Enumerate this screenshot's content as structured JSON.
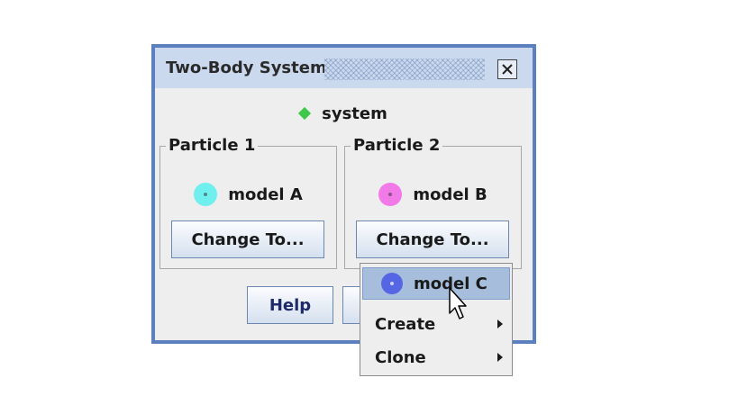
{
  "window": {
    "title": "Two-Body System",
    "system_label": "system",
    "particle1": {
      "legend": "Particle 1",
      "model": "model A",
      "change_label": "Change To..."
    },
    "particle2": {
      "legend": "Particle 2",
      "model": "model B",
      "change_label": "Change To..."
    },
    "help_label": "Help"
  },
  "popup_menu": {
    "items": [
      {
        "label": "model C"
      },
      {
        "label": "Create"
      },
      {
        "label": "Clone"
      }
    ]
  },
  "colors": {
    "system_diamond": "#3ec84a",
    "model_a": "#6ff0ee",
    "model_b": "#f27ae8",
    "model_c": "#5565e4",
    "window_frame": "#5b7fbf"
  },
  "icons": {
    "close": "close-icon",
    "submenu": "submenu-arrow-icon",
    "cursor": "mouse-pointer-icon"
  }
}
